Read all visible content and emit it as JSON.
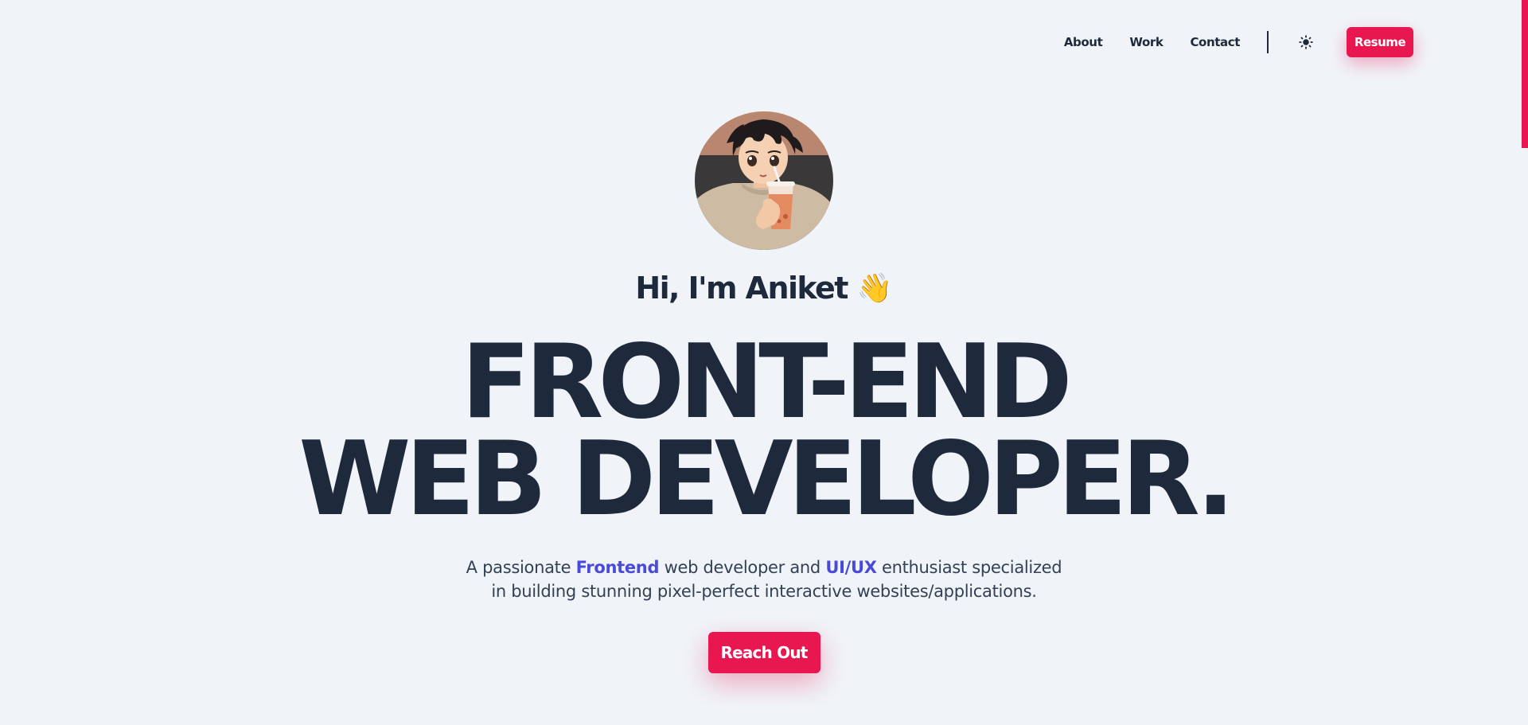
{
  "nav": {
    "links": [
      "About",
      "Work",
      "Contact"
    ],
    "theme_icon": "sun-icon",
    "resume_label": "Resume"
  },
  "hero": {
    "avatar_icon": "avatar-illustration",
    "greeting": "Hi, I'm Aniket",
    "greeting_emoji": "👋",
    "headline_line1": "FRONT-END",
    "headline_line2": "WEB DEVELOPER.",
    "tagline": {
      "part1": "A passionate ",
      "accent1": "Frontend",
      "part2": " web developer and ",
      "accent2": "UI/UX",
      "part3": " enthusiast specialized in building stunning pixel-perfect interactive websites/applications."
    },
    "cta_label": "Reach Out"
  },
  "colors": {
    "background": "#f0f4f9",
    "text": "#1e293b",
    "accent_pink": "#e8174f",
    "accent_blue": "#4a4ad8"
  }
}
